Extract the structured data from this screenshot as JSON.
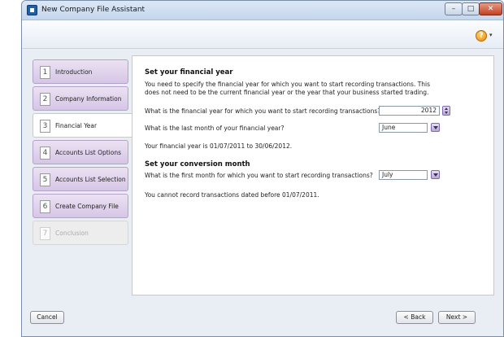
{
  "window": {
    "title": "New Company File Assistant"
  },
  "steps": [
    {
      "num": "1",
      "label": "Introduction",
      "state": "normal"
    },
    {
      "num": "2",
      "label": "Company Information",
      "state": "normal"
    },
    {
      "num": "3",
      "label": "Financial Year",
      "state": "active"
    },
    {
      "num": "4",
      "label": "Accounts List Options",
      "state": "normal"
    },
    {
      "num": "5",
      "label": "Accounts List Selection",
      "state": "normal"
    },
    {
      "num": "6",
      "label": "Create Company File",
      "state": "normal"
    },
    {
      "num": "7",
      "label": "Conclusion",
      "state": "disabled"
    }
  ],
  "financial_year": {
    "heading": "Set your financial year",
    "intro_line1": "You need to specify the financial year for which you want to start recording transactions. This",
    "intro_line2": "does not need to be the current financial year or the year that your business started trading.",
    "year_question": "What is the financial year for which you want to start recording transactions?",
    "year_value": "2012",
    "month_question": "What is the last month of your financial year?",
    "month_value": "June",
    "summary": "Your financial year is 01/07/2011 to 30/06/2012."
  },
  "conversion": {
    "heading": "Set your conversion month",
    "month_question": "What is the first month for which you want to start recording transactions?",
    "month_value": "July",
    "note": "You cannot record transactions dated before 01/07/2011."
  },
  "buttons": {
    "cancel": "Cancel",
    "back": "< Back",
    "next": "Next >"
  },
  "icons": {
    "help": "?",
    "help_dropdown": "▾"
  }
}
